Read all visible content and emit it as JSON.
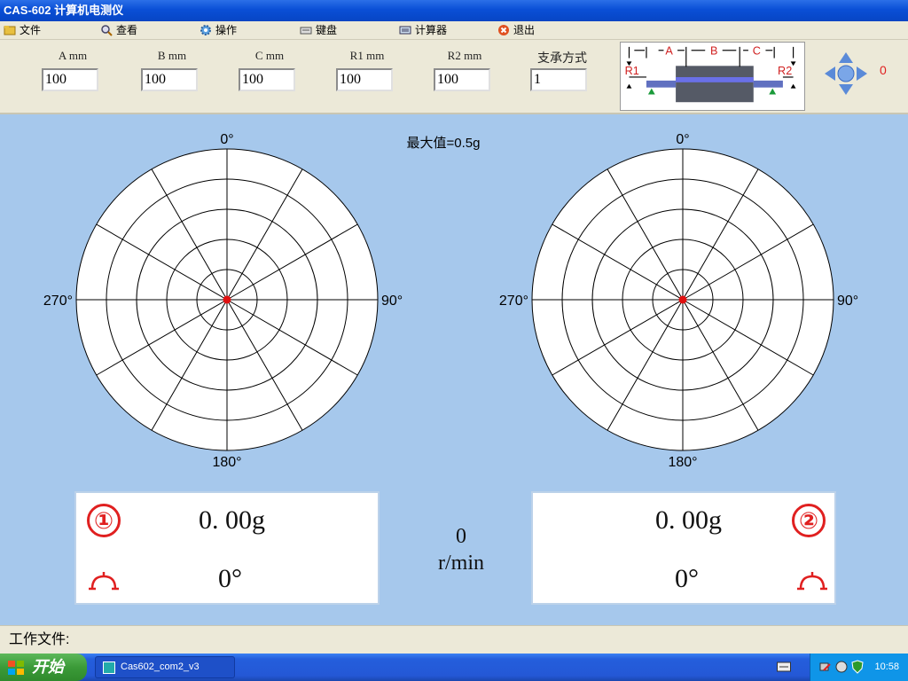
{
  "window": {
    "title": "CAS-602 计算机电测仪"
  },
  "menu": [
    {
      "label": "文件",
      "icon": "folder-icon"
    },
    {
      "label": "查看",
      "icon": "magnifier-icon"
    },
    {
      "label": "操作",
      "icon": "gear-icon"
    },
    {
      "label": "键盘",
      "icon": "keyboard-icon"
    },
    {
      "label": "计算器",
      "icon": "calculator-icon"
    },
    {
      "label": "退出",
      "icon": "exit-icon"
    }
  ],
  "params": [
    {
      "label": "A mm",
      "value": "100"
    },
    {
      "label": "B mm",
      "value": "100"
    },
    {
      "label": "C mm",
      "value": "100"
    },
    {
      "label": "R1 mm",
      "value": "100"
    },
    {
      "label": "R2 mm",
      "value": "100"
    },
    {
      "label": "支承方式",
      "value": "1"
    }
  ],
  "diagram": {
    "a": "A",
    "b": "B",
    "c": "C",
    "r1": "R1",
    "r2": "R2"
  },
  "counter": "0",
  "max_label": "最大值=0.5g",
  "polar_labels": {
    "top": "0°",
    "right": "90°",
    "bottom": "180°",
    "left": "270°"
  },
  "channel1": {
    "number": "①",
    "amplitude": "0. 00g",
    "angle": "0°"
  },
  "channel2": {
    "number": "②",
    "amplitude": "0. 00g",
    "angle": "0°"
  },
  "speed": {
    "value": "0",
    "unit": "r/min"
  },
  "status": {
    "label": "工作文件:"
  },
  "taskbar": {
    "start": "开始",
    "task": "Cas602_com2_v3",
    "time": "10:58"
  },
  "colors": {
    "accent": "#e02020",
    "background": "#a6c8ec"
  }
}
